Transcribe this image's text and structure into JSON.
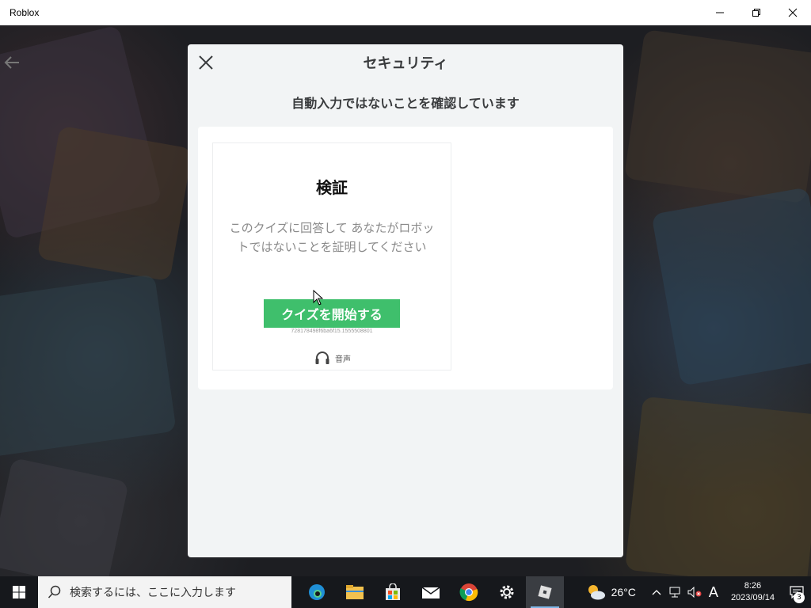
{
  "window": {
    "title": "Roblox"
  },
  "modal": {
    "title": "セキュリティ",
    "subtitle": "自動入力ではないことを確認しています",
    "card": {
      "heading": "検証",
      "description": "このクイズに回答して あなたがロボットではないことを証明してください",
      "start_button": "クイズを開始する",
      "session_id": "728178498f6ba6f15.1555508801",
      "audio_label": "音声"
    }
  },
  "taskbar": {
    "search_placeholder": "検索するには、ここに入力します",
    "weather_temp": "26°C",
    "ime_mode": "A",
    "clock_time": "8:26",
    "clock_date": "2023/09/14",
    "notification_count": "3",
    "apps": [
      "edge-icon",
      "file-explorer-icon",
      "store-icon",
      "mail-icon",
      "chrome-icon",
      "settings-icon",
      "roblox-icon"
    ]
  },
  "colors": {
    "accent_green": "#3fbf6c",
    "modal_bg": "#f2f4f5",
    "taskbar_bg": "#16181c"
  }
}
